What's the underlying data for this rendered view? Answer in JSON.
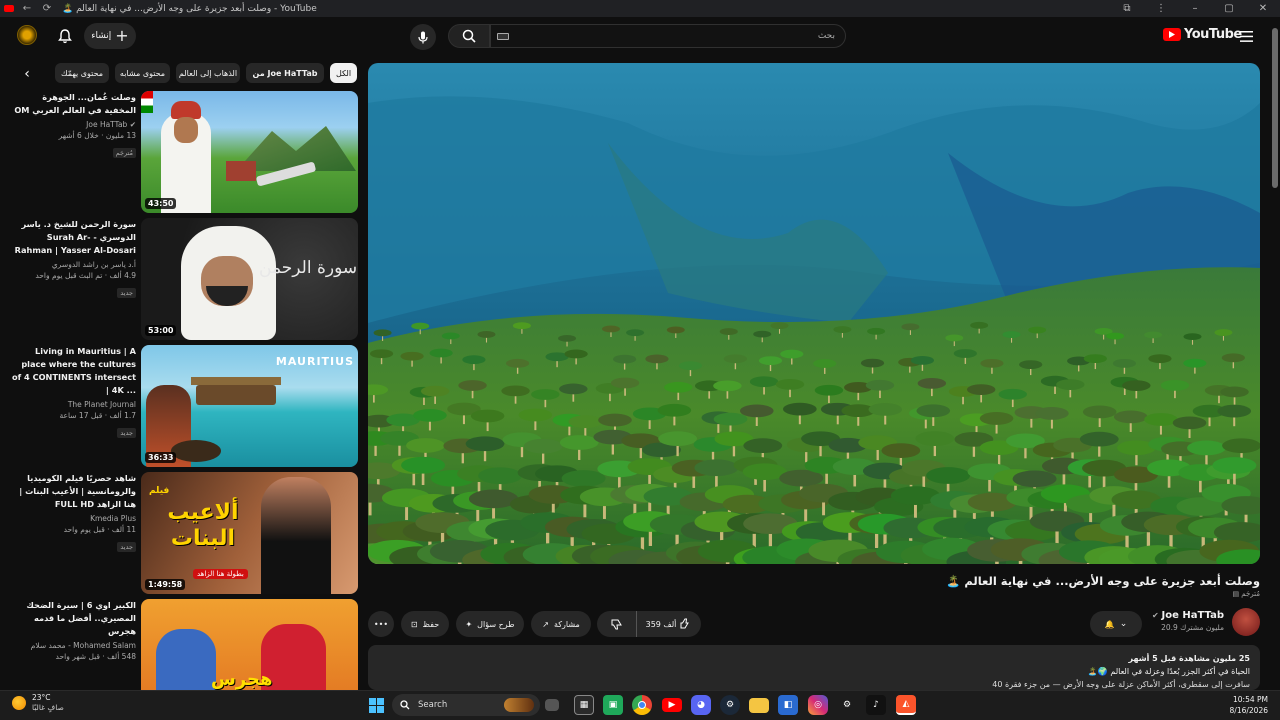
{
  "browser": {
    "tab_title": "YouTube - وصلت أبعد جزيرة على وجه الأرض... في نهاية العالم 🏝️"
  },
  "header": {
    "search_placeholder": "بحث",
    "create_label": "إنشاء",
    "logo_text": "YouTube"
  },
  "chips": [
    "الكل",
    "من Joe HaTTab",
    "الذهاب إلى العالم",
    "محتوى مشابه",
    "محتوى يهمّك"
  ],
  "recommendations": [
    {
      "title": "وصلت عُمان... الجوهرة المخفية في العالم العربي OM",
      "channel": "Joe HaTTab",
      "stats": "13 مليون · خلال 6 أشهر",
      "badge": "مُترجَم",
      "duration": "43:50"
    },
    {
      "title": "سورة الرحمن للشيخ د. ياسر الدوسري - Surah Ar-Rahman | Yasser Al-Dosari",
      "channel": "أ.د ياسر بن راشد الدوسري",
      "stats": "4.9 ألف · تم البث قبل يوم واحد",
      "badge": "جديد",
      "duration": "53:00"
    },
    {
      "title": "Living in Mauritius | A place where the cultures of 4 CONTINENTS intersect | 4K ...",
      "channel": "The Planet Journal",
      "stats": "1.7 ألف · قبل 17 ساعة",
      "badge": "جديد",
      "duration": "36:33"
    },
    {
      "title": "شاهد حصريًا فيلم الكوميديا والرومانسية | الأعيب البنات | هنا الزاهد FULL HD",
      "channel": "Kmedia Plus",
      "stats": "11 ألف · قبل يوم واحد",
      "badge": "جديد",
      "duration": "1:49:58"
    },
    {
      "title": "الكبير اوي 6 | سيرة الضحك المصيري.. أفضل ما قدمه هجرس",
      "channel": "Mohamed Salam - محمد سلام",
      "stats": "548 ألف · قبل شهر واحد",
      "badge": "",
      "duration": ""
    }
  ],
  "thumb_texts": {
    "mauritius": "MAURITIUS",
    "film_title": "ألاعيب البنات",
    "film_label": "فيلم",
    "film_tag": "بطولة هنا الزاهد",
    "surah": "سورة الرحمن",
    "hagras": "هجرس"
  },
  "video": {
    "title": "وصلت أبعد جزيرة على وجه الأرض... في نهاية العالم 🏝️",
    "tag": "مُترجَم",
    "channel": "Joe HaTTab",
    "subscribers": "20.9 مليون مشترك",
    "likes": "359 ألف",
    "share": "مشاركة",
    "ask": "طرح سؤال",
    "save": "حفظ",
    "views_date": "25 مليون مشاهدة  قبل 5 أشهر",
    "desc_line1": "الحياة في أكثر الجزر بُعدًا وعزلة في العالم 🌍🏝️",
    "desc_line2": "سافرت إلى سقطرى، أكثر الأماكن عزلة على وجه الأرض — من جزء فقرة 40"
  },
  "taskbar": {
    "weather_temp": "23°C",
    "weather_text": "صافٍ غالبًا",
    "search_label": "Search",
    "time": "10:54 PM",
    "date": "8/16/2026"
  },
  "colors": {
    "accent_red": "#ff0000",
    "background": "#0f0f0f",
    "chip": "#272727"
  }
}
